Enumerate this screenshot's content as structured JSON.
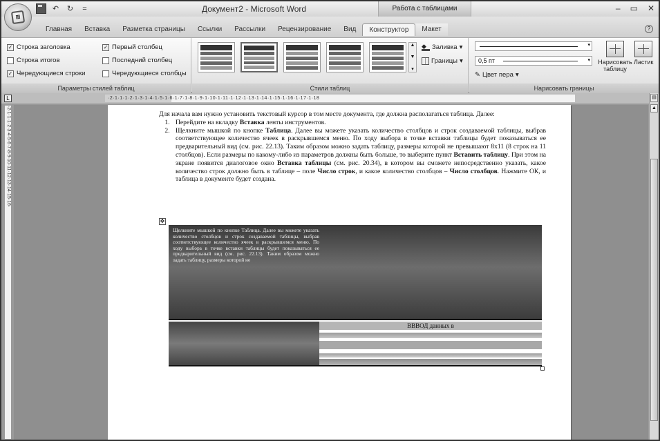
{
  "window": {
    "title": "Документ2 - Microsoft Word",
    "context_title": "Работа с таблицами",
    "controls": [
      "–",
      "▭",
      "✕"
    ]
  },
  "qat": {
    "undo": "↶",
    "redo": "↻",
    "more": "="
  },
  "tabs": [
    {
      "label": "Главная"
    },
    {
      "label": "Вставка"
    },
    {
      "label": "Разметка страницы"
    },
    {
      "label": "Ссылки"
    },
    {
      "label": "Рассылки"
    },
    {
      "label": "Рецензирование"
    },
    {
      "label": "Вид"
    },
    {
      "label": "Конструктор"
    },
    {
      "label": "Макет"
    }
  ],
  "ribbon": {
    "options_group": {
      "label": "Параметры стилей таблиц",
      "checks": [
        {
          "label": "Строка заголовка",
          "checked": true
        },
        {
          "label": "Строка итогов",
          "checked": false
        },
        {
          "label": "Чередующиеся строки",
          "checked": true
        },
        {
          "label": "Первый столбец",
          "checked": true
        },
        {
          "label": "Последний столбец",
          "checked": false
        },
        {
          "label": "Чередующиеся столбцы",
          "checked": false
        }
      ]
    },
    "styles_group": {
      "label": "Стили таблиц",
      "fill": "Заливка",
      "borders": "Границы"
    },
    "draw_group": {
      "label": "Нарисовать границы",
      "weight": "0,5 пт",
      "pen_color": "Цвет пера",
      "draw_table": "Нарисовать таблицу",
      "eraser": "Ластик"
    }
  },
  "ruler": {
    "horizontal": "·2·1·1·1·2·1·3·1·4·1·5·1·6·1·7·1·8·1·9·1·10·1·11·1·12·1·13·1·14·1·15·1·16·1·17·1·18",
    "vertical": "·2·1·1·1·2·3·4·5·6·7·8·9·10·11·12·13·14·15·16·"
  },
  "document": {
    "intro": "Для начала вам нужно установить текстовый курсор в том месте документа, где должна располагаться таблица. Далее:",
    "step1_a": "Перейдите на вкладку ",
    "step1_b": "Вставка",
    "step1_c": " ленты инструментов.",
    "step2_a": "Щелкните мышкой по кнопке ",
    "step2_b": "Таблица",
    "step2_c": ". Далее вы можете указать количество столбцов и строк создаваемой таблицы, выбрав соответствующее количество ячеек в раскрывшемся меню. По ходу выбора в точке вставки таблицы будет показываться ее предварительный вид (см. рис. 22.13). Таким образом можно задать таблицу, размеры которой не превышают 8x11 (8 строк на 11 столбцов). Если размеры по какому-либо из параметров должны быть больше, то выберите пункт ",
    "step2_d": "Вставить таблицу",
    "step2_e": ". При этом на экране появится диалоговое окно ",
    "step2_f": "Вставка таблицы",
    "step2_g": " (см. рис. 20.34), в котором вы сможете непосредственно указать, какое количество строк должно быть в таблице – поле ",
    "step2_h": "Число строк",
    "step2_i": ", и какое количество столбцов – ",
    "step2_j": "Число столбцов",
    "step2_k": ". Нажмите ОК, и таблица в документе будет создана.",
    "table_cell_text": "Щелкните мышкой по кнопке Таблица. Далее вы можете указать количество столбцов и строк создаваемой таблицы, выбрав соответствующее количество ячеек в раскрывшемся меню. По ходу выбора в точке вставки таблицы будет показываться ее предварительный вид (см. рис. 22.13). Таким образом можно задать таблицу, размеры которой не",
    "table_cell_header": "ВВВОД данных в"
  }
}
